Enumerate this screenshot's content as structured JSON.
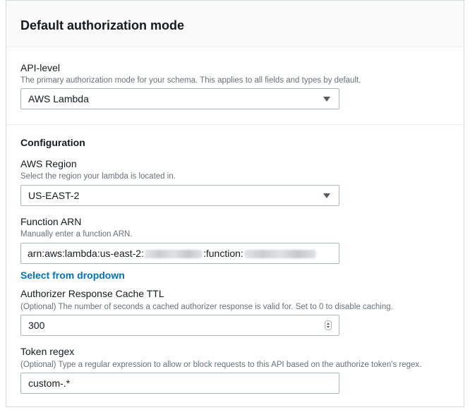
{
  "panel": {
    "title": "Default authorization mode"
  },
  "api_level": {
    "label": "API-level",
    "description": "The primary authorization mode for your schema. This applies to all fields and types by default.",
    "selected": "AWS Lambda"
  },
  "configuration": {
    "heading": "Configuration",
    "region": {
      "label": "AWS Region",
      "description": "Select the region your lambda is located in.",
      "selected": "US-EAST-2"
    },
    "function_arn": {
      "label": "Function ARN",
      "description": "Manually enter a function ARN.",
      "value_prefix": "arn:aws:lambda:us-east-2:",
      "value_middle": ":function:"
    },
    "select_link": "Select from dropdown",
    "cache_ttl": {
      "label": "Authorizer Response Cache TTL",
      "description": "(Optional) The number of seconds a cached authorizer response is valid for. Set to 0 to disable caching.",
      "value": "300"
    },
    "token_regex": {
      "label": "Token regex",
      "description": "(Optional) Type a regular expression to allow or block requests to this API based on the authorize token's regex.",
      "value": "custom-.*"
    }
  }
}
